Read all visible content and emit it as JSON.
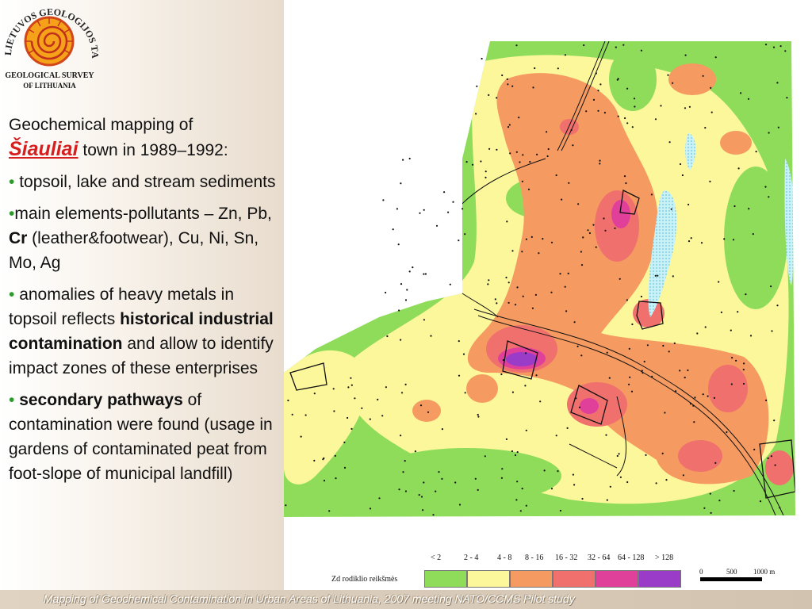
{
  "logo": {
    "arc_text": "LIETUVOS GEOLOGIJOS TARNYBA",
    "line1": "GEOLOGICAL SURVEY",
    "line2": "OF LITHUANIA"
  },
  "intro": {
    "line1": "Geochemical mapping of",
    "city": "Šiauliai",
    "line2_rest": " town in 1989–1992:"
  },
  "bullets": [
    {
      "symbol": "•",
      "text": " topsoil, lake and stream sediments"
    },
    {
      "symbol": "•",
      "text_before": "main elements-pollutants – Zn, Pb, ",
      "bold": "Cr",
      "text_after": " (leather&footwear), Cu, Ni, Sn, Mo, Ag"
    },
    {
      "symbol": "•",
      "text_before": " anomalies of heavy metals in topsoil reflects ",
      "bold": "historical industrial contamination",
      "text_after": " and allow to identify impact zones of these enterprises"
    },
    {
      "symbol": "•",
      "text_before": " ",
      "bold": "secondary pathways",
      "text_after": " of contamination were found (usage in gardens of contaminated peat from foot-slope of municipal landfill)"
    }
  ],
  "legend": {
    "title": "Zd rodiklio reikšmės",
    "classes": [
      {
        "label": "<  2",
        "color": "#8fdc5a"
      },
      {
        "label": "2 - 4",
        "color": "#fdf79c"
      },
      {
        "label": "4 - 8",
        "color": "#f59a60"
      },
      {
        "label": "8 - 16",
        "color": "#f0706e"
      },
      {
        "label": "16 - 32",
        "color": "#f0706e"
      },
      {
        "label": "32 - 64",
        "color": "#e0409a"
      },
      {
        "label": "64 - 128",
        "color": "#e0409a"
      },
      {
        "label": ">  128",
        "color": "#9a3cc8"
      }
    ]
  },
  "scale": {
    "labels": [
      "0",
      "500",
      "1000 m"
    ]
  },
  "colors": {
    "background_map": "#8fdc5a",
    "water": "#aee8f2"
  },
  "footer": "Mapping of Geochemical Contamination in Urban Areas of Lithuania, 2007 meeting NATO/CCMS Pilot study"
}
